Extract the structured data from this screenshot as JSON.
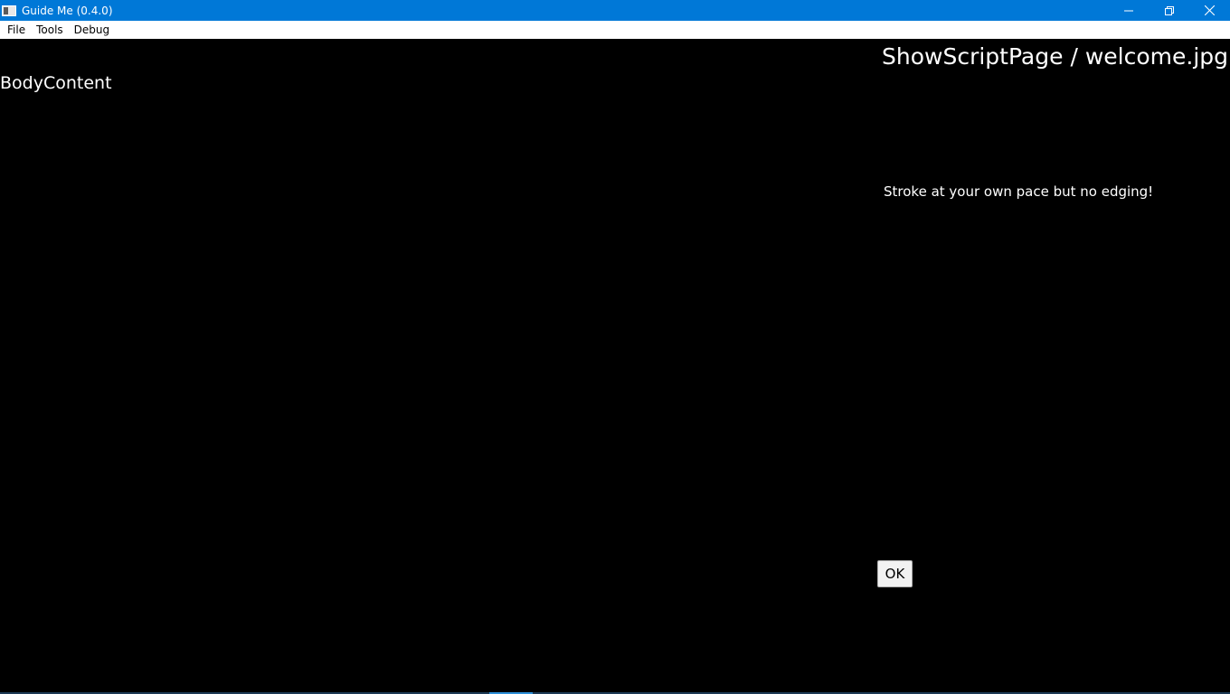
{
  "window": {
    "title": "Guide Me (0.4.0)",
    "controls": [
      {
        "name": "minimize",
        "icon": "minimize-icon"
      },
      {
        "name": "restore",
        "icon": "restore-icon"
      },
      {
        "name": "close",
        "icon": "close-icon"
      }
    ],
    "accent_color": "#0078d7"
  },
  "menu": {
    "items": [
      "File",
      "Tools",
      "Debug"
    ]
  },
  "page": {
    "header": "ShowScriptPage / welcome.jpg",
    "body_label": "BodyContent",
    "message": "Stroke at your own pace but no edging!",
    "ok_label": "OK",
    "background_color": "#000000",
    "text_color": "#ffffff"
  }
}
